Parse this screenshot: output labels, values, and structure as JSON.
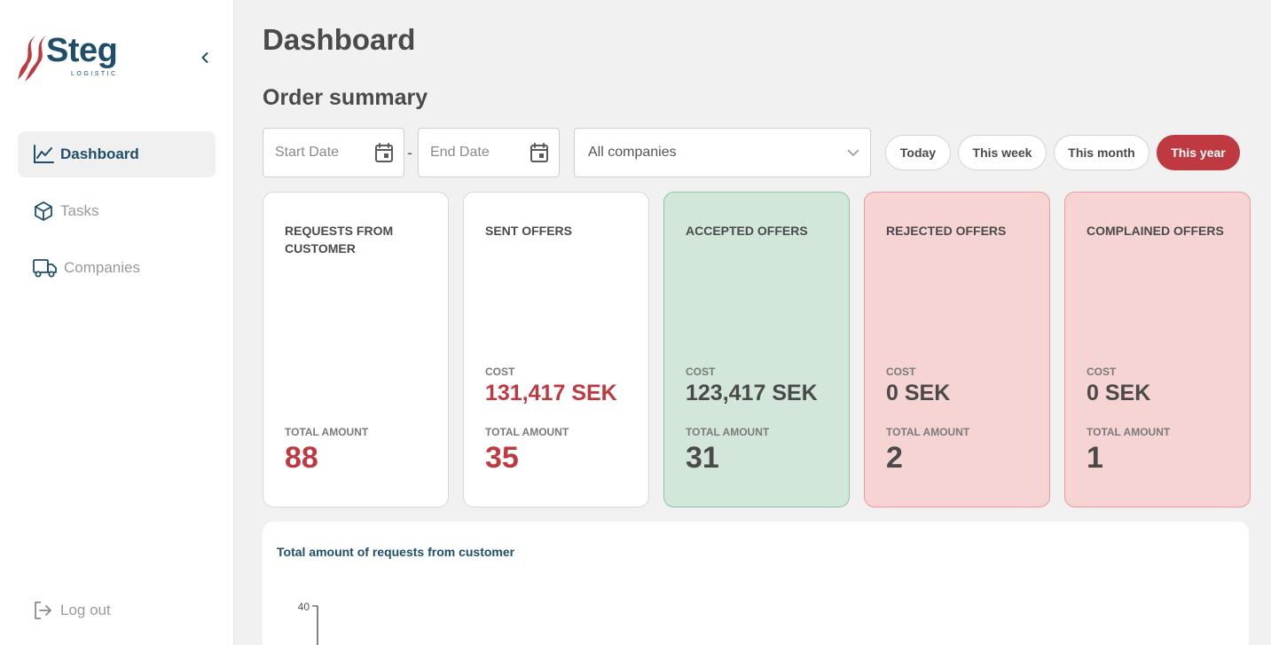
{
  "brand": {
    "name": "Steg",
    "subtitle": "LOGISTIC",
    "accent": "#bf3a40",
    "primary": "#1f4e6b"
  },
  "sidebar": {
    "collapse_icon": "chevron-left-icon",
    "items": [
      {
        "label": "Dashboard",
        "icon": "chart-line-icon",
        "active": true
      },
      {
        "label": "Tasks",
        "icon": "box-icon",
        "active": false
      },
      {
        "label": "Companies",
        "icon": "truck-icon",
        "active": false
      }
    ],
    "logout": {
      "label": "Log out",
      "icon": "logout-icon"
    }
  },
  "header": {
    "title": "Dashboard",
    "section_title": "Order summary"
  },
  "filters": {
    "start_date": {
      "placeholder": "Start Date",
      "value": ""
    },
    "separator": "-",
    "end_date": {
      "placeholder": "End Date",
      "value": ""
    },
    "company": {
      "selected": "All companies"
    },
    "periods": [
      {
        "label": "Today",
        "active": false
      },
      {
        "label": "This week",
        "active": false
      },
      {
        "label": "This month",
        "active": false
      },
      {
        "label": "This year",
        "active": true
      }
    ]
  },
  "cards": [
    {
      "title": "REQUESTS FROM CUSTOMER",
      "cost_label": "",
      "cost": "",
      "total_label": "TOTAL AMOUNT",
      "total": "88",
      "variant": "white"
    },
    {
      "title": "SENT OFFERS",
      "cost_label": "COST",
      "cost": "131,417 SEK",
      "total_label": "TOTAL AMOUNT",
      "total": "35",
      "variant": "white"
    },
    {
      "title": "ACCEPTED OFFERS",
      "cost_label": "COST",
      "cost": "123,417 SEK",
      "total_label": "TOTAL AMOUNT",
      "total": "31",
      "variant": "green"
    },
    {
      "title": "REJECTED OFFERS",
      "cost_label": "COST",
      "cost": "0 SEK",
      "total_label": "TOTAL AMOUNT",
      "total": "2",
      "variant": "red"
    },
    {
      "title": "COMPLAINED OFFERS",
      "cost_label": "COST",
      "cost": "0 SEK",
      "total_label": "TOTAL AMOUNT",
      "total": "1",
      "variant": "red"
    }
  ],
  "chart": {
    "title": "Total amount of requests from customer",
    "y_tick_top": "40"
  },
  "chart_data": {
    "type": "bar",
    "title": "Total amount of requests from customer",
    "yticks": [
      "40"
    ],
    "series": []
  }
}
